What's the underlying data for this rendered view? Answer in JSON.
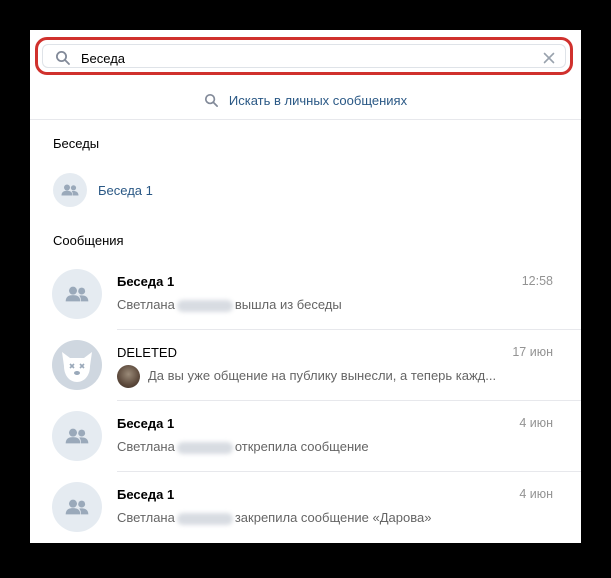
{
  "search": {
    "value": "Беседа"
  },
  "global_search_label": "Искать в личных сообщениях",
  "sections": {
    "chats_title": "Беседы",
    "messages_title": "Сообщения"
  },
  "chats": [
    {
      "name": "Беседа 1"
    }
  ],
  "messages": [
    {
      "title": "Беседа 1",
      "time": "12:58",
      "text_before": "Светлана",
      "text_after": "вышла из беседы",
      "avatar": "group-icon"
    },
    {
      "title": "DELETED",
      "time": "17 июн",
      "text": "Да вы уже общение на публику вынесли, а теперь кажд...",
      "avatar": "deleted-dog-icon"
    },
    {
      "title": "Беседа 1",
      "time": "4 июн",
      "text_before": "Светлана",
      "text_after": "открепила сообщение",
      "avatar": "group-icon"
    },
    {
      "title": "Беседа 1",
      "time": "4 июн",
      "text_before": "Светлана",
      "text_after": "закрепила сообщение «Дарова»",
      "avatar": "group-icon"
    }
  ],
  "colors": {
    "accent_link": "#2a5885",
    "highlight_border": "#d0312d",
    "avatar_bg": "#e5ebf1"
  }
}
